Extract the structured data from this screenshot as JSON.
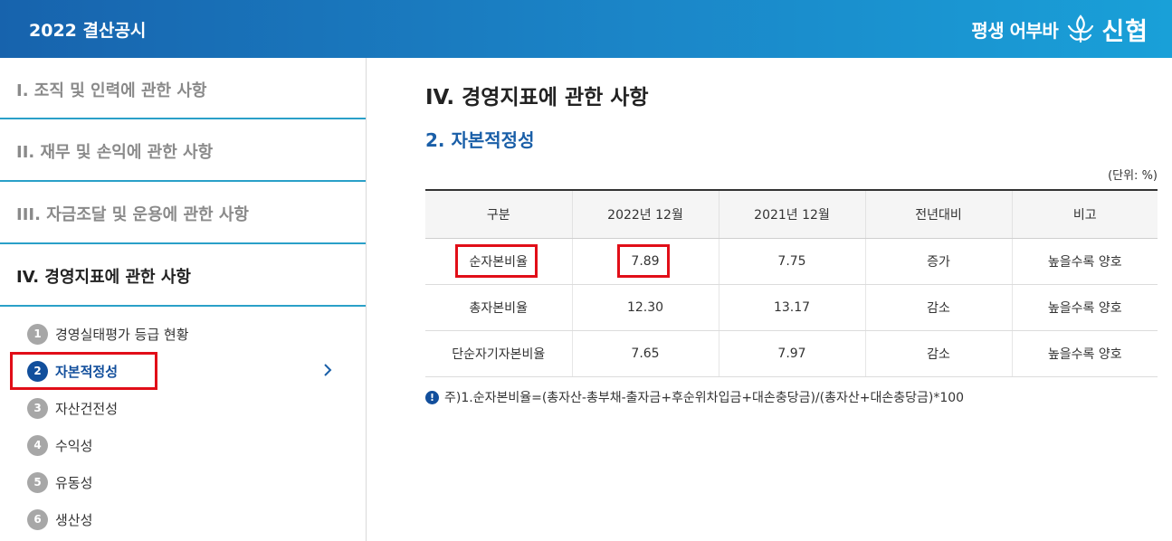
{
  "header": {
    "title": "2022 결산공시",
    "slogan": "평생 어부바",
    "brand": "신협"
  },
  "sidebar": {
    "sections": [
      {
        "label": "I. 조직 및 인력에 관한 사항"
      },
      {
        "label": "II. 재무 및 손익에 관한 사항"
      },
      {
        "label": "III. 자금조달 및 운용에 관한 사항"
      },
      {
        "label": "IV. 경영지표에 관한 사항"
      }
    ],
    "items": [
      {
        "num": "1",
        "label": "경영실태평가 등급 현황"
      },
      {
        "num": "2",
        "label": "자본적정성"
      },
      {
        "num": "3",
        "label": "자산건전성"
      },
      {
        "num": "4",
        "label": "수익성"
      },
      {
        "num": "5",
        "label": "유동성"
      },
      {
        "num": "6",
        "label": "생산성"
      }
    ]
  },
  "main": {
    "title": "IV. 경영지표에 관한 사항",
    "subtitle": "2. 자본적정성",
    "unit": "(단위: %)",
    "table": {
      "headers": [
        "구분",
        "2022년 12월",
        "2021년 12월",
        "전년대비",
        "비고"
      ],
      "rows": [
        [
          "순자본비율",
          "7.89",
          "7.75",
          "증가",
          "높을수록 양호"
        ],
        [
          "총자본비율",
          "12.30",
          "13.17",
          "감소",
          "높을수록 양호"
        ],
        [
          "단순자기자본비율",
          "7.65",
          "7.97",
          "감소",
          "높을수록 양호"
        ]
      ]
    },
    "note_icon": "!",
    "note": "주)1.순자본비율=(총자산-총부채-출자금+후순위차입금+대손충당금)/(총자산+대손충당금)*100"
  },
  "colors": {
    "header_start": "#1763ad",
    "header_end": "#19a0d8",
    "active": "#124f9c",
    "highlight": "#e10e18",
    "section_rule": "#2aa0c8"
  }
}
